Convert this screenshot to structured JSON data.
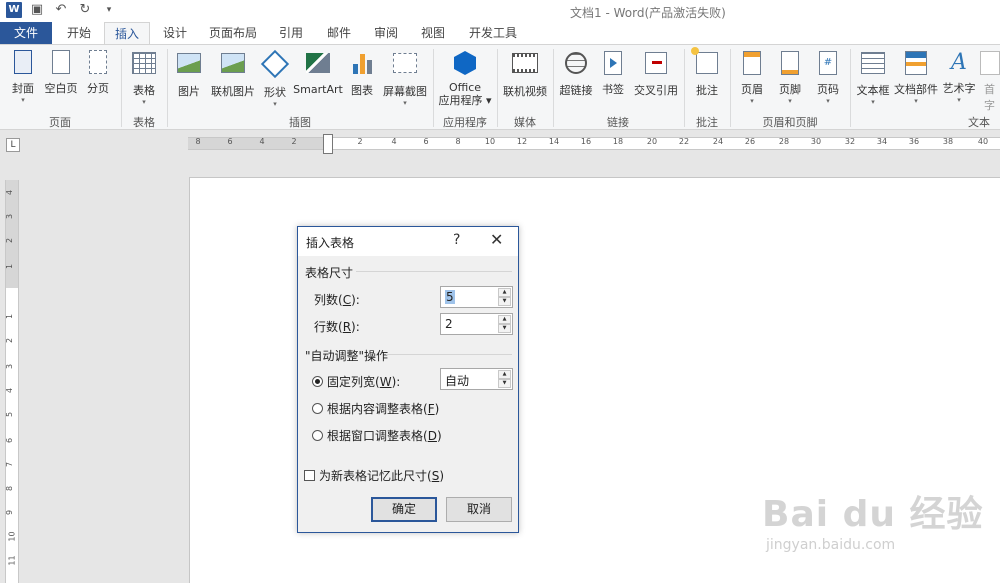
{
  "window": {
    "title": "文档1 - Word(产品激活失败)"
  },
  "qat": {
    "icons": [
      "word-logo",
      "save-icon",
      "undo-icon",
      "redo-icon",
      "customize-icon"
    ],
    "word_logo": "W"
  },
  "tabs": [
    {
      "label": "文件"
    },
    {
      "label": "开始"
    },
    {
      "label": "插入",
      "active": true
    },
    {
      "label": "设计"
    },
    {
      "label": "页面布局"
    },
    {
      "label": "引用"
    },
    {
      "label": "邮件"
    },
    {
      "label": "审阅"
    },
    {
      "label": "视图"
    },
    {
      "label": "开发工具"
    }
  ],
  "ribbon": {
    "buttons": {
      "cover": "封面",
      "blank_page": "空白页",
      "page_break": "分页",
      "table": "表格",
      "pictures": "图片",
      "online_pictures": "联机图片",
      "shapes": "形状",
      "smartart": "SmartArt",
      "chart": "图表",
      "screenshot": "屏幕截图",
      "office_apps_line1": "Office",
      "office_apps_line2": "应用程序",
      "online_video": "联机视频",
      "hyperlink": "超链接",
      "bookmark": "书签",
      "cross_ref": "交叉引用",
      "comment": "批注",
      "header": "页眉",
      "footer": "页脚",
      "page_number": "页码",
      "textbox": "文本框",
      "quick_parts": "文档部件",
      "wordart": "艺术字",
      "dropcap": "首字"
    },
    "groups": {
      "pages": "页面",
      "tables": "表格",
      "illustrations": "插图",
      "apps": "应用程序",
      "media": "媒体",
      "links": "链接",
      "comments": "批注",
      "header_footer": "页眉和页脚",
      "text": "文本"
    },
    "page_number_glyph": "#",
    "wordart_glyph": "A"
  },
  "ruler": {
    "corner": "L",
    "h_numbers": [
      "8",
      "6",
      "4",
      "2",
      "2",
      "4",
      "6",
      "8",
      "10",
      "12",
      "14",
      "16",
      "18",
      "20",
      "22",
      "24",
      "26",
      "28",
      "30",
      "32",
      "34",
      "36",
      "38",
      "40"
    ],
    "v_numbers": [
      "4",
      "3",
      "2",
      "1",
      "1",
      "2",
      "3",
      "4",
      "5",
      "6",
      "7",
      "8",
      "9",
      "10",
      "11"
    ]
  },
  "dialog": {
    "title": "插入表格",
    "help": "?",
    "close": "✕",
    "size_section": "表格尺寸",
    "columns_label": "列数(",
    "columns_key": "C",
    "columns_suffix": "):",
    "columns_value": "5",
    "rows_label": "行数(",
    "rows_key": "R",
    "rows_suffix": "):",
    "rows_value": "2",
    "autofit_section": "\"自动调整\"操作",
    "fixed_label": "固定列宽(",
    "fixed_key": "W",
    "fixed_suffix": "):",
    "fixed_value": "自动",
    "fit_content_label": "根据内容调整表格(",
    "fit_content_key": "F",
    "fit_content_suffix": ")",
    "fit_window_label": "根据窗口调整表格(",
    "fit_window_key": "D",
    "fit_window_suffix": ")",
    "remember_label": "为新表格记忆此尺寸(",
    "remember_key": "S",
    "remember_suffix": ")",
    "ok": "确定",
    "cancel": "取消",
    "selected_option": "fixed",
    "remember_checked": false
  },
  "watermark": {
    "logo": "Bai du 经验",
    "url": "jingyan.baidu.com"
  },
  "colors": {
    "accent": "#2b579a",
    "ribbon_bg": "#f5f6f7",
    "doc_bg": "#e6e6e6"
  }
}
